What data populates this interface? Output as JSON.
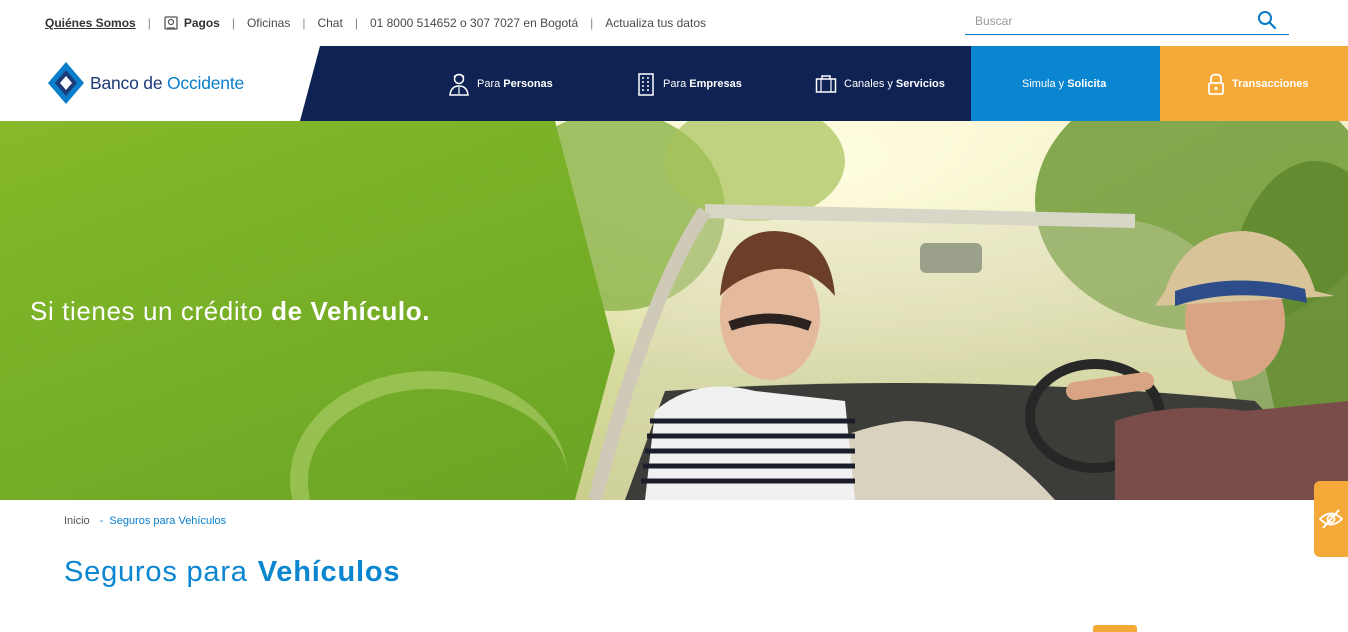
{
  "topbar": {
    "links": {
      "quienes_somos": "Quiénes Somos",
      "pagos": "Pagos",
      "oficinas": "Oficinas",
      "chat": "Chat",
      "telefono": "01 8000 514652 o 307 7027 en Bogotá",
      "actualiza": "Actualiza tus datos"
    },
    "separator": "|",
    "search_placeholder": "Buscar"
  },
  "logo": {
    "brand_a": "Banco de ",
    "brand_b": "Occidente"
  },
  "nav": {
    "personas": {
      "prefix": "Para",
      "bold": "Personas"
    },
    "empresas": {
      "prefix": "Para",
      "bold": "Empresas"
    },
    "canales": {
      "prefix": "Canales y",
      "bold": "Servicios"
    },
    "simula": {
      "prefix": "Simula y",
      "bold": "Solicita"
    },
    "transacciones": {
      "bold": "Transacciones"
    }
  },
  "hero": {
    "headline_a": "Si tienes un crédito",
    "headline_b": "de Vehículo."
  },
  "breadcrumb": {
    "home": "Inicio",
    "dash": "-",
    "current": "Seguros para Vehículos"
  },
  "page": {
    "title_a": "Seguros para",
    "title_b": "Vehículos"
  },
  "colors": {
    "navy": "#0e2253",
    "blue": "#0a86d0",
    "orange": "#f5a938",
    "green": "#78b027"
  },
  "icons": [
    "clipboard-icon",
    "search-icon",
    "logo-diamond-icon",
    "person-icon",
    "building-icon",
    "briefcase-icon",
    "lock-icon",
    "eye-slash-icon"
  ]
}
